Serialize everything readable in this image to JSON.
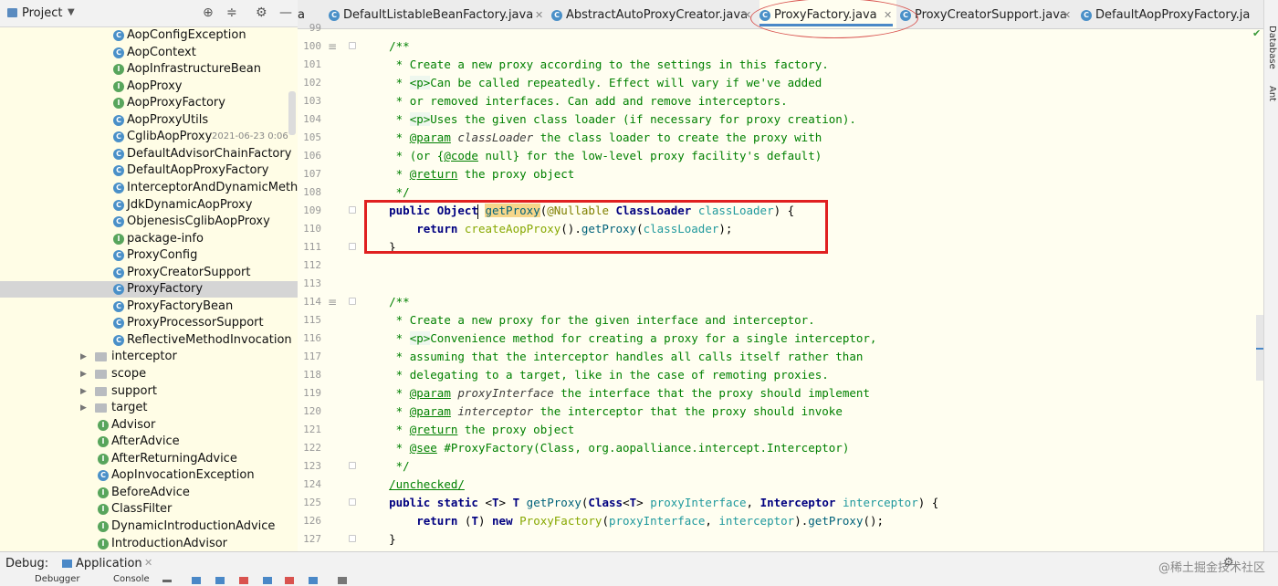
{
  "project_panel": {
    "title": "Project",
    "icons": [
      "target-icon",
      "collapse-icon",
      "gear-icon",
      "minimize-icon"
    ],
    "tree": [
      {
        "label": "AopConfigException",
        "kind": "class",
        "indent": 2
      },
      {
        "label": "AopContext",
        "kind": "class",
        "indent": 2
      },
      {
        "label": "AopInfrastructureBean",
        "kind": "interface",
        "indent": 2
      },
      {
        "label": "AopProxy",
        "kind": "interface",
        "indent": 2
      },
      {
        "label": "AopProxyFactory",
        "kind": "interface",
        "indent": 2
      },
      {
        "label": "AopProxyUtils",
        "kind": "class",
        "indent": 2
      },
      {
        "label": "CglibAopProxy",
        "kind": "class",
        "indent": 2,
        "timestamp": "2021-06-23 0:06"
      },
      {
        "label": "DefaultAdvisorChainFactory",
        "kind": "class",
        "indent": 2
      },
      {
        "label": "DefaultAopProxyFactory",
        "kind": "class",
        "indent": 2
      },
      {
        "label": "InterceptorAndDynamicMethod",
        "kind": "class",
        "indent": 2
      },
      {
        "label": "JdkDynamicAopProxy",
        "kind": "class",
        "indent": 2
      },
      {
        "label": "ObjenesisCglibAopProxy",
        "kind": "class",
        "indent": 2
      },
      {
        "label": "package-info",
        "kind": "interface",
        "indent": 2
      },
      {
        "label": "ProxyConfig",
        "kind": "class",
        "indent": 2
      },
      {
        "label": "ProxyCreatorSupport",
        "kind": "class",
        "indent": 2
      },
      {
        "label": "ProxyFactory",
        "kind": "class",
        "indent": 2,
        "selected": true
      },
      {
        "label": "ProxyFactoryBean",
        "kind": "class",
        "indent": 2
      },
      {
        "label": "ProxyProcessorSupport",
        "kind": "class",
        "indent": 2
      },
      {
        "label": "ReflectiveMethodInvocation",
        "kind": "class",
        "indent": 2
      },
      {
        "label": "interceptor",
        "kind": "folder",
        "indent": 1
      },
      {
        "label": "scope",
        "kind": "folder",
        "indent": 1
      },
      {
        "label": "support",
        "kind": "folder",
        "indent": 1
      },
      {
        "label": "target",
        "kind": "folder",
        "indent": 1
      },
      {
        "label": "Advisor",
        "kind": "interface",
        "indent": 1
      },
      {
        "label": "AfterAdvice",
        "kind": "interface",
        "indent": 1
      },
      {
        "label": "AfterReturningAdvice",
        "kind": "interface",
        "indent": 1
      },
      {
        "label": "AopInvocationException",
        "kind": "class",
        "indent": 1
      },
      {
        "label": "BeforeAdvice",
        "kind": "interface",
        "indent": 1
      },
      {
        "label": "ClassFilter",
        "kind": "interface",
        "indent": 1
      },
      {
        "label": "DynamicIntroductionAdvice",
        "kind": "interface",
        "indent": 1
      },
      {
        "label": "IntroductionAdvisor",
        "kind": "interface",
        "indent": 1
      }
    ]
  },
  "tabs": [
    {
      "label": "a",
      "partial": true
    },
    {
      "label": "DefaultListableBeanFactory.java"
    },
    {
      "label": "AbstractAutoProxyCreator.java"
    },
    {
      "label": "ProxyFactory.java",
      "active": true
    },
    {
      "label": "ProxyCreatorSupport.java"
    },
    {
      "label": "DefaultAopProxyFactory.ja"
    }
  ],
  "editor": {
    "line_numbers": [
      "99",
      "100",
      "101",
      "102",
      "103",
      "104",
      "105",
      "106",
      "107",
      "108",
      "109",
      "110",
      "111",
      "112",
      "113",
      "114",
      "115",
      "116",
      "117",
      "118",
      "119",
      "120",
      "121",
      "122",
      "123",
      "124",
      "125",
      "126",
      "127"
    ],
    "highlighted_lines": [
      "109",
      "110",
      "111"
    ]
  },
  "right_strip": {
    "labels": [
      "Database",
      "Ant"
    ]
  },
  "bottom": {
    "debug_label": "Debug:",
    "tab_label": "Application",
    "subtoolbar": [
      "Debugger",
      "Console"
    ],
    "watermark": "@稀土掘金技术社区"
  }
}
